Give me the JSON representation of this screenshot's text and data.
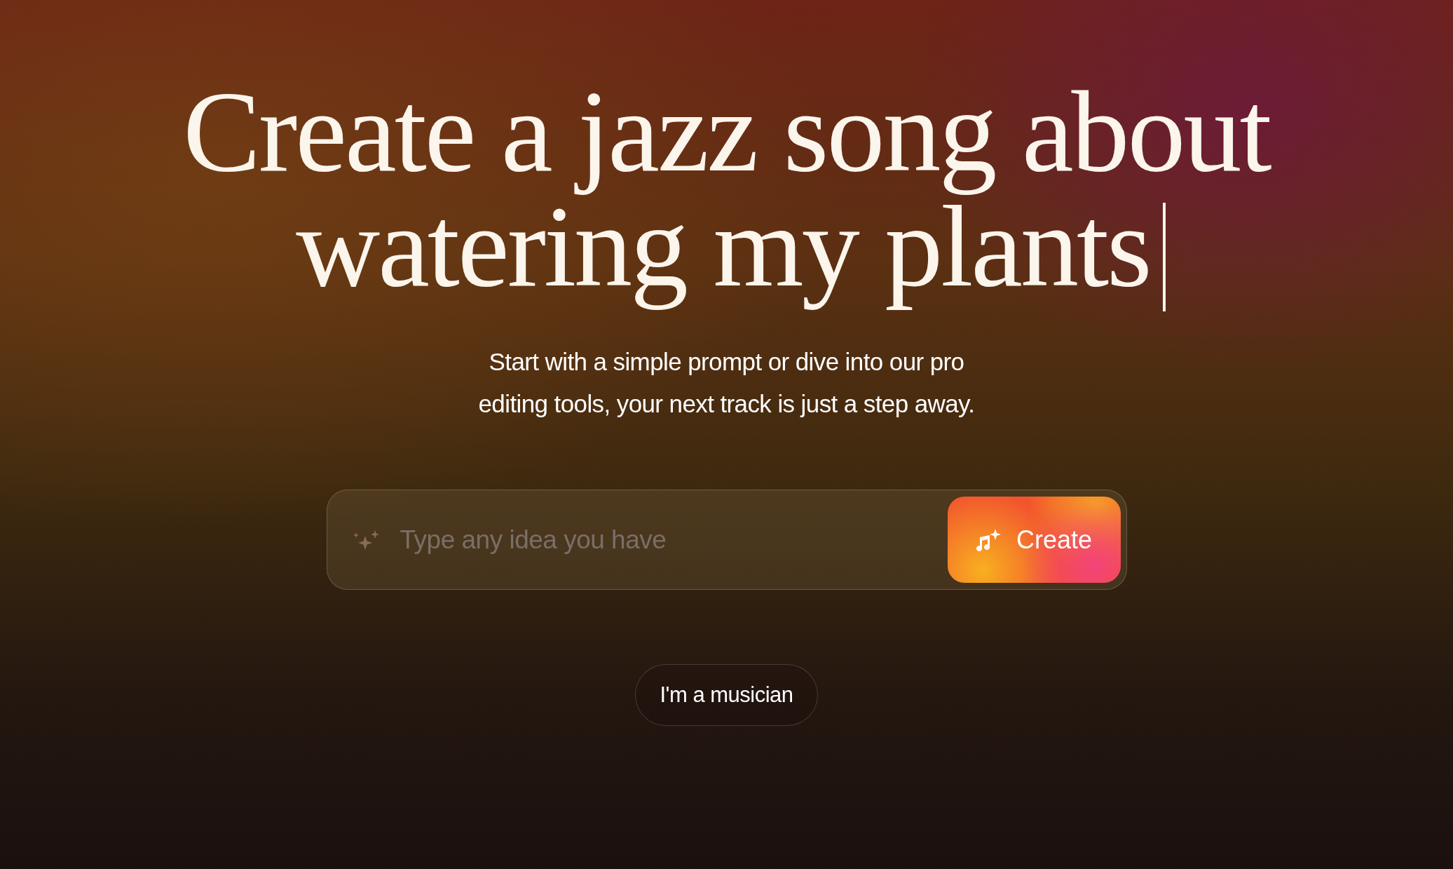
{
  "headline": {
    "lines": [
      "Create a jazz song about",
      "watering my plants"
    ],
    "cursor": true
  },
  "subtitle": {
    "lines": [
      "Start with a simple prompt or dive into our pro",
      "editing tools, your next track is just a step away."
    ]
  },
  "prompt": {
    "placeholder": "Type any idea you have",
    "button": "Create"
  },
  "secondary_button": "I'm a musician"
}
